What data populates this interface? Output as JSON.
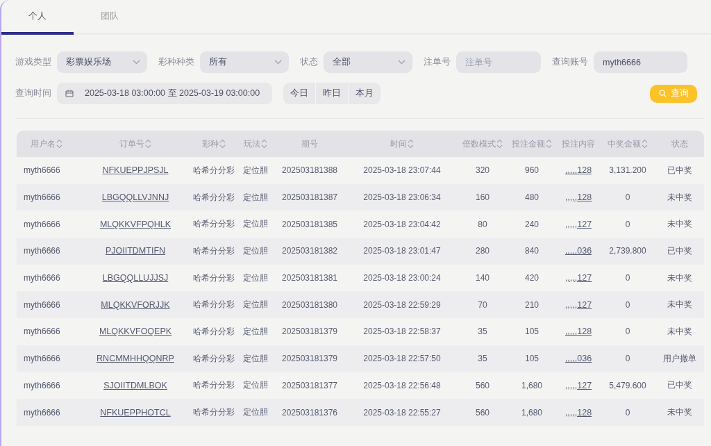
{
  "tabs": [
    {
      "label": "个人",
      "selected": true
    },
    {
      "label": "团队",
      "selected": false
    }
  ],
  "filters": [
    {
      "kind": "select",
      "label": "游戏类型",
      "value": "彩票娱乐场"
    },
    {
      "kind": "select",
      "label": "彩种种类",
      "value": "所有"
    },
    {
      "kind": "select",
      "label": "状态",
      "value": "全部"
    },
    {
      "kind": "input",
      "label": "注单号",
      "placeholder": "注单号"
    },
    {
      "kind": "input",
      "label": "查询账号",
      "value": "myth6666"
    }
  ],
  "time_filter": {
    "label": "查询时间",
    "value": "2025-03-18 03:00:00 至 2025-03-19 03:00:00"
  },
  "quick_ranges": [
    "今日",
    "昨日",
    "本月"
  ],
  "query_button": {
    "label": "查询"
  },
  "table": {
    "columns": [
      {
        "label": "用户名",
        "sortable": true
      },
      {
        "label": "订单号",
        "sortable": true
      },
      {
        "label": "彩种",
        "sortable": true
      },
      {
        "label": "玩法",
        "sortable": true
      },
      {
        "label": "期号",
        "sortable": false
      },
      {
        "label": "时间",
        "sortable": true
      },
      {
        "label": "倍数模式",
        "sortable": true
      },
      {
        "label": "投注金额",
        "sortable": true
      },
      {
        "label": "投注内容",
        "sortable": false
      },
      {
        "label": "中奖金额",
        "sortable": true
      },
      {
        "label": "状态",
        "sortable": false
      }
    ],
    "rows": [
      {
        "username": "myth6666",
        "order_no": "NFKUEPPJPSJL",
        "lottery": "哈希分分彩",
        "play": "定位胆",
        "issue": "202503181388",
        "time": "2025-03-18 23:07:44",
        "multiplier": "320",
        "bet_amount": "960",
        "bet_content": ",,,,,128",
        "win_amount": "3,131.200",
        "status": "已中奖"
      },
      {
        "username": "myth6666",
        "order_no": "LBGQQLLVJNNJ",
        "lottery": "哈希分分彩",
        "play": "定位胆",
        "issue": "202503181387",
        "time": "2025-03-18 23:06:34",
        "multiplier": "160",
        "bet_amount": "480",
        "bet_content": ",,,,,128",
        "win_amount": "0",
        "status": "未中奖"
      },
      {
        "username": "myth6666",
        "order_no": "MLQKKVFPQHLK",
        "lottery": "哈希分分彩",
        "play": "定位胆",
        "issue": "202503181385",
        "time": "2025-03-18 23:04:42",
        "multiplier": "80",
        "bet_amount": "240",
        "bet_content": ",,,,,127",
        "win_amount": "0",
        "status": "未中奖"
      },
      {
        "username": "myth6666",
        "order_no": "PJOIITDMTIFN",
        "lottery": "哈希分分彩",
        "play": "定位胆",
        "issue": "202503181382",
        "time": "2025-03-18 23:01:47",
        "multiplier": "280",
        "bet_amount": "840",
        "bet_content": ",,,,,036",
        "win_amount": "2,739.800",
        "status": "已中奖"
      },
      {
        "username": "myth6666",
        "order_no": "LBGQQLLUJJSJ",
        "lottery": "哈希分分彩",
        "play": "定位胆",
        "issue": "202503181381",
        "time": "2025-03-18 23:00:24",
        "multiplier": "140",
        "bet_amount": "420",
        "bet_content": ",,,,,127",
        "win_amount": "0",
        "status": "未中奖"
      },
      {
        "username": "myth6666",
        "order_no": "MLQKKVFORJJK",
        "lottery": "哈希分分彩",
        "play": "定位胆",
        "issue": "202503181380",
        "time": "2025-03-18 22:59:29",
        "multiplier": "70",
        "bet_amount": "210",
        "bet_content": ",,,,,127",
        "win_amount": "0",
        "status": "未中奖"
      },
      {
        "username": "myth6666",
        "order_no": "MLQKKVFOQEPK",
        "lottery": "哈希分分彩",
        "play": "定位胆",
        "issue": "202503181379",
        "time": "2025-03-18 22:58:37",
        "multiplier": "35",
        "bet_amount": "105",
        "bet_content": ",,,,,128",
        "win_amount": "0",
        "status": "未中奖"
      },
      {
        "username": "myth6666",
        "order_no": "RNCMMHHQQNRP",
        "lottery": "哈希分分彩",
        "play": "定位胆",
        "issue": "202503181379",
        "time": "2025-03-18 22:57:50",
        "multiplier": "35",
        "bet_amount": "105",
        "bet_content": ",,,,,036",
        "win_amount": "0",
        "status": "用户撤单"
      },
      {
        "username": "myth6666",
        "order_no": "SJOIITDMLBOK",
        "lottery": "哈希分分彩",
        "play": "定位胆",
        "issue": "202503181377",
        "time": "2025-03-18 22:56:48",
        "multiplier": "560",
        "bet_amount": "1,680",
        "bet_content": ",,,,,127",
        "win_amount": "5,479.600",
        "status": "已中奖"
      },
      {
        "username": "myth6666",
        "order_no": "NFKUEPPHOTCL",
        "lottery": "哈希分分彩",
        "play": "定位胆",
        "issue": "202503181376",
        "time": "2025-03-18 22:55:27",
        "multiplier": "560",
        "bet_amount": "1,680",
        "bet_content": ",,,,,128",
        "win_amount": "0",
        "status": "未中奖"
      }
    ]
  }
}
